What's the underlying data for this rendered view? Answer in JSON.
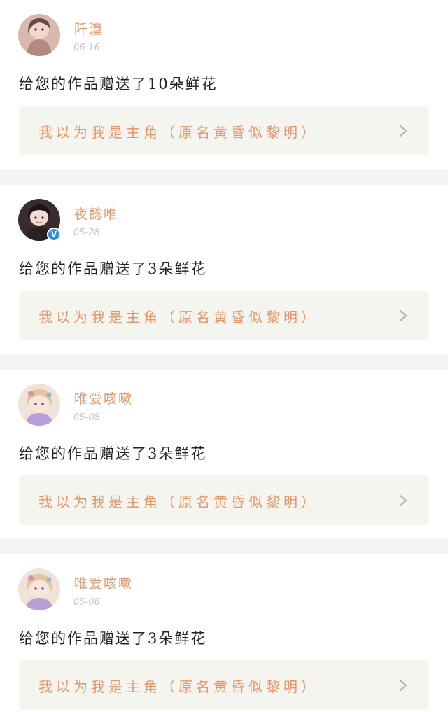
{
  "notifications": [
    {
      "username": "阡潼",
      "date": "06-16",
      "message": "给您的作品赠送了10朵鲜花",
      "work_title": "我以为我是主角（原名黄昏似黎明）",
      "verified": false,
      "avatar_icon": "user-avatar-1"
    },
    {
      "username": "夜懿唯",
      "date": "05-28",
      "message": "给您的作品赠送了3朵鲜花",
      "work_title": "我以为我是主角（原名黄昏似黎明）",
      "verified": true,
      "avatar_icon": "user-avatar-2"
    },
    {
      "username": "唯爱咳嗽",
      "date": "05-08",
      "message": "给您的作品赠送了3朵鲜花",
      "work_title": "我以为我是主角（原名黄昏似黎明）",
      "verified": false,
      "avatar_icon": "user-avatar-3"
    },
    {
      "username": "唯爱咳嗽",
      "date": "05-08",
      "message": "给您的作品赠送了3朵鲜花",
      "work_title": "我以为我是主角（原名黄昏似黎明）",
      "verified": false,
      "avatar_icon": "user-avatar-3"
    }
  ],
  "verified_icon_glyph": "V",
  "colors": {
    "accent": "#e8956a",
    "link_background": "#f5f5ef",
    "divider": "#f4f4f4",
    "date": "#c6c6c6",
    "verified": "#2f8fe0"
  }
}
